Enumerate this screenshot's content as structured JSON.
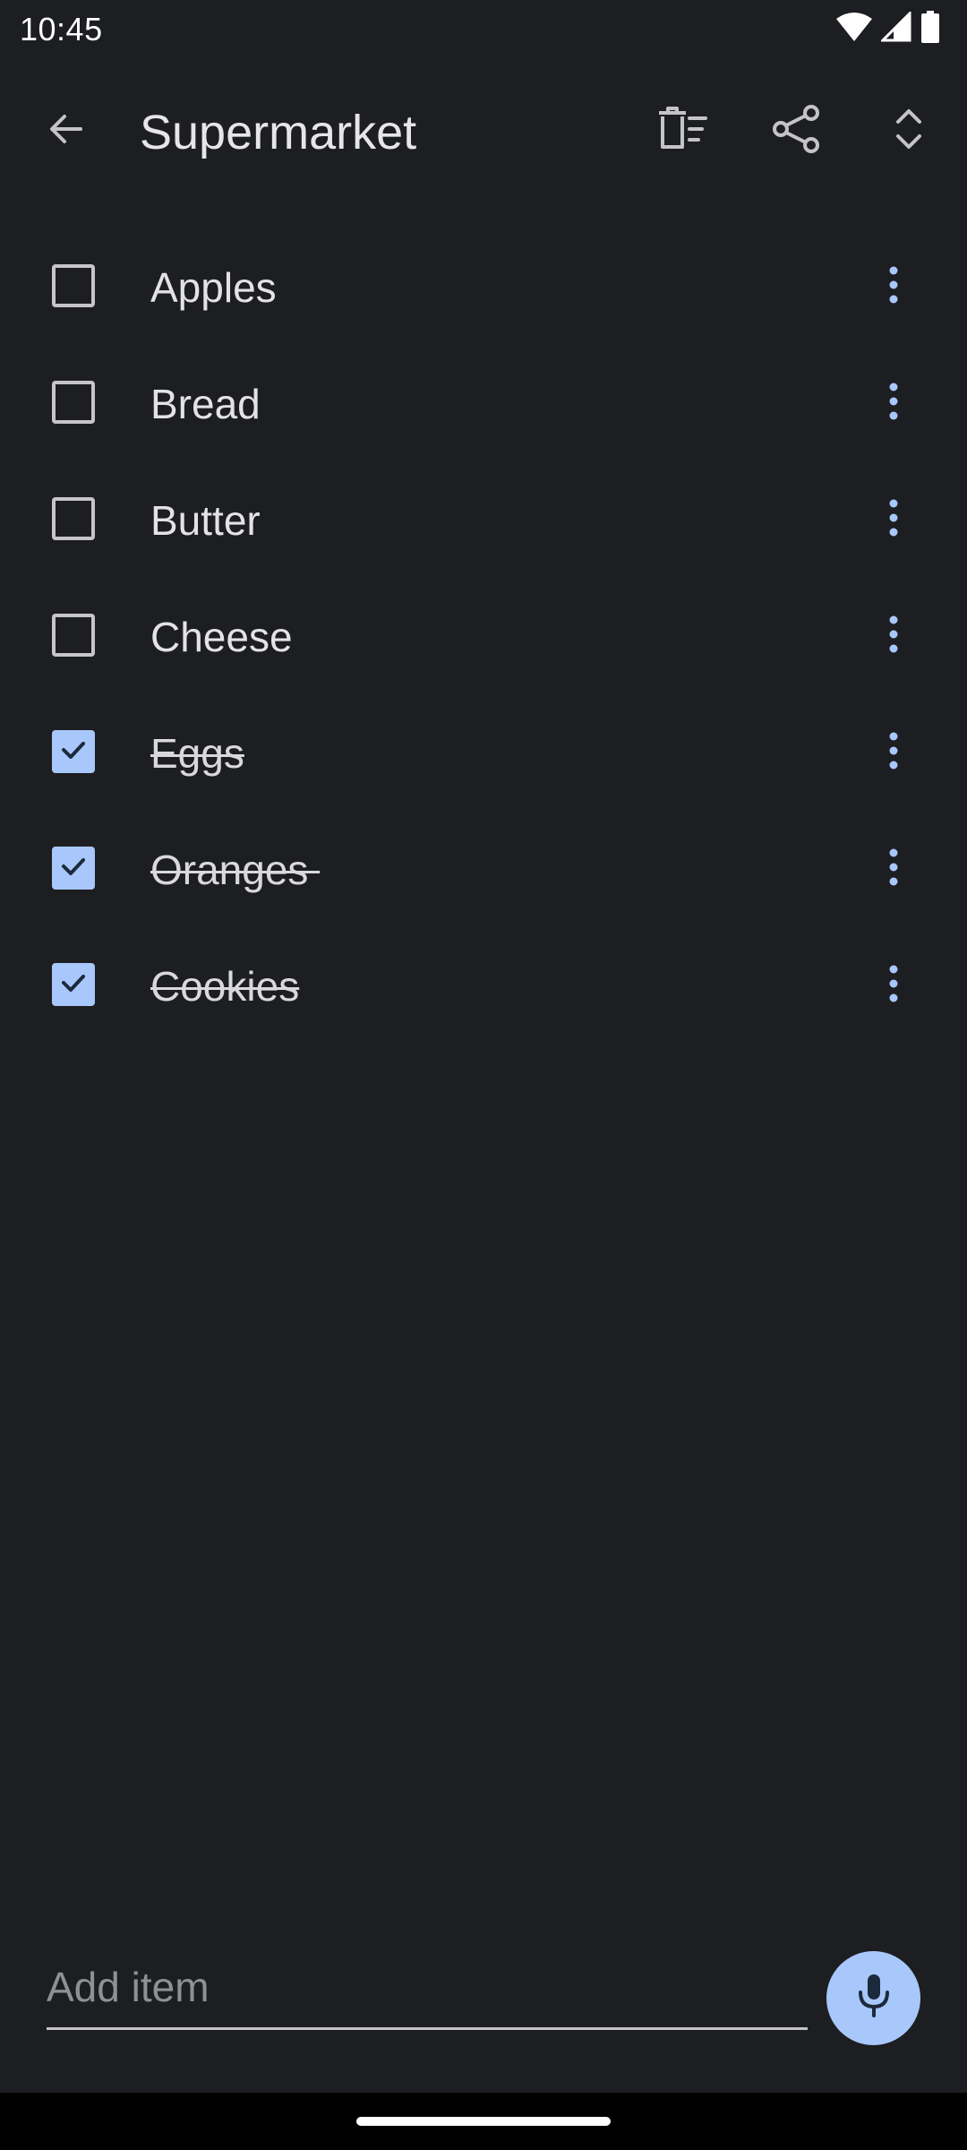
{
  "status_bar": {
    "time": "10:45",
    "icons": [
      "wifi-icon",
      "cell-signal-icon",
      "battery-icon"
    ]
  },
  "app_bar": {
    "back_icon": "arrow-back-icon",
    "title": "Supermarket",
    "actions": [
      "delete-checked-icon",
      "share-icon",
      "expand-collapse-icon"
    ]
  },
  "list": {
    "items": [
      {
        "label": "Apples",
        "checked": false
      },
      {
        "label": "Bread",
        "checked": false
      },
      {
        "label": "Butter",
        "checked": false
      },
      {
        "label": "Cheese",
        "checked": false
      },
      {
        "label": "Eggs",
        "checked": true
      },
      {
        "label": "Oranges ",
        "checked": true
      },
      {
        "label": "Cookies",
        "checked": true
      }
    ]
  },
  "add_item": {
    "placeholder": "Add item",
    "value": ""
  },
  "colors": {
    "background": "#1d1e21",
    "accent": "#a8c8fb",
    "text": "#e3e3e6"
  }
}
